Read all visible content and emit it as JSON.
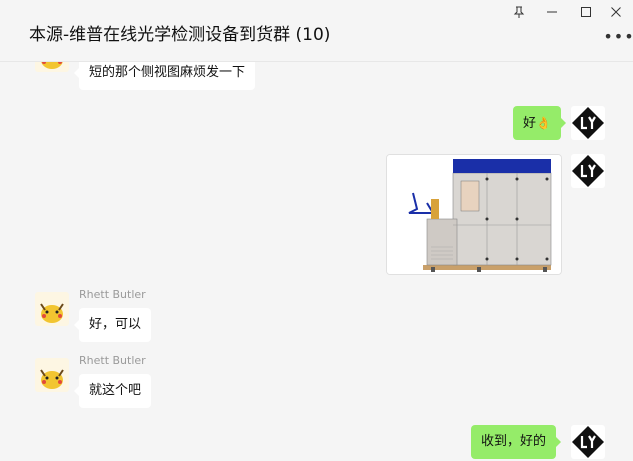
{
  "window": {
    "title": "本源-维普在线光学检测设备到货群 (10)",
    "pin_icon": "pin-icon",
    "minimize_icon": "minimize-icon",
    "maximize_icon": "maximize-icon",
    "close_icon": "close-icon",
    "more_icon": "more-icon"
  },
  "messages": [
    {
      "side": "left",
      "text": "短的那个侧视图麻烦发一下"
    },
    {
      "side": "right",
      "text": "好",
      "emoji": "👌"
    },
    {
      "side": "right",
      "type": "image",
      "description": "machine-photo"
    },
    {
      "side": "left",
      "sender": "Rhett Butler",
      "text": "好，可以"
    },
    {
      "side": "left",
      "sender": "Rhett Butler",
      "text": "就这个吧"
    },
    {
      "side": "right",
      "text": "收到，好的"
    }
  ],
  "colors": {
    "self_bubble": "#95ec69",
    "other_bubble": "#ffffff",
    "background": "#f5f5f5"
  }
}
